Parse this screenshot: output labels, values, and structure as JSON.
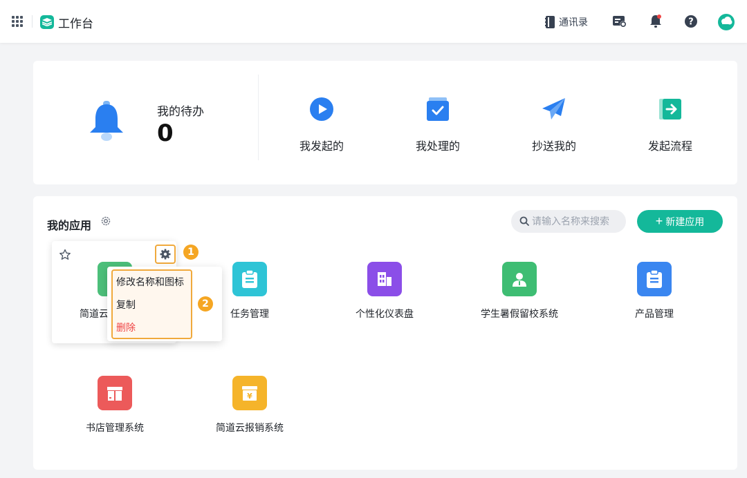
{
  "topbar": {
    "title": "工作台",
    "contacts_label": "通讯录",
    "icons": [
      "grid-menu-icon",
      "brand-icon",
      "contacts-book-icon",
      "task-list-icon",
      "notification-bell-icon",
      "help-icon",
      "user-avatar"
    ],
    "brand_color": "#14b89a"
  },
  "todo": {
    "label": "我的待办",
    "count": "0",
    "flows": [
      {
        "label": "我发起的",
        "icon": "play-circle-icon"
      },
      {
        "label": "我处理的",
        "icon": "check-box-icon"
      },
      {
        "label": "抄送我的",
        "icon": "paper-plane-icon"
      },
      {
        "label": "发起流程",
        "icon": "exit-arrow-icon"
      }
    ]
  },
  "apps": {
    "title": "我的应用",
    "search_placeholder": "请输入名称来搜索",
    "new_button": "新建应用",
    "new_button_icon": "+",
    "items": [
      {
        "name": "简道云",
        "color": "#4cbf7a",
        "icon": "app-icon"
      },
      {
        "name": "任务管理",
        "color": "#2ec4d6",
        "icon": "clipboard-icon"
      },
      {
        "name": "个性化仪表盘",
        "color": "#8b4ee8",
        "icon": "building-chart-icon"
      },
      {
        "name": "学生暑假留校系统",
        "color": "#3ebd73",
        "icon": "person-badge-icon"
      },
      {
        "name": "产品管理",
        "color": "#3a86f0",
        "icon": "clipboard-icon"
      },
      {
        "name": "书店管理系统",
        "color": "#ec5a5a",
        "icon": "book-shelf-icon"
      },
      {
        "name": "简道云报销系统",
        "color": "#f5b42a",
        "icon": "yen-box-icon"
      }
    ]
  },
  "context_menu": {
    "items": [
      "修改名称和图标",
      "复制",
      "删除"
    ],
    "danger_color": "#ef4444",
    "step_badges": [
      "1",
      "2"
    ],
    "highlight_color": "#f0a93c"
  }
}
